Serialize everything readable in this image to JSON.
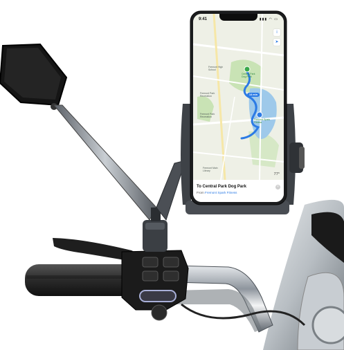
{
  "phone": {
    "status_time": "9:41",
    "status_icons": "▮▮▮ ◠ ▭",
    "map_labels": {
      "park": "Central Park\nDog Park",
      "route_time": "14 min",
      "gym": "Fremont Spark\nFitness",
      "label_a": "Fremont High\nSchool",
      "label_b": "Fremont Park\nRecreation",
      "label_c": "Fremont Park\nRecreation",
      "label_d": "Fremont Main\nLibrary"
    },
    "temperature": "77°",
    "directions": {
      "destination": "To Central Park Dog Park",
      "from_label": "From",
      "from_place": "Fremont Spark Fitness"
    }
  },
  "colors": {
    "route": "#2c7be5",
    "lake": "#9ec9ea",
    "park": "#c9e3b5",
    "chrome": "#9aa2ab",
    "mount": "#4b4f55"
  }
}
